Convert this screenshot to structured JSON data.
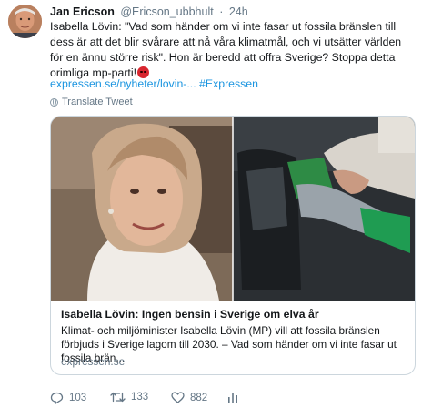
{
  "author": {
    "name": "Jan Ericson",
    "handle": "@Ericson_ubbhult",
    "separator": "·",
    "time": "24h"
  },
  "tweet": {
    "text": "Isabella Lövin: \"Vad som händer om vi inte fasar ut fossila bränslen till dess är att det blir svårare att nå våra klimatmål, och vi utsätter världen för en ännu större risk\". Hon är beredd att offra Sverige? Stoppa detta orimliga mp-parti!",
    "emoji": "angry-face-emoji",
    "link": "expressen.se/nyheter/lovin-...",
    "hashtag": "#Expressen",
    "translate_label": "Translate Tweet"
  },
  "card": {
    "title": "Isabella Lövin: Ingen bensin i Sverige om elva år",
    "description": "Klimat- och miljöminister Isabella Lövin (MP) vill att fossila bränslen förbjuds i Sverige lagom till 2030. – Vad som händer om vi inte fasar ut fossila brän...",
    "domain": "expressen.se",
    "left_image": "portrait-photo",
    "right_image": "fuel-nozzle-photo"
  },
  "actions": {
    "reply_count": "103",
    "retweet_count": "133",
    "like_count": "882",
    "icons": [
      "reply-icon",
      "retweet-icon",
      "like-icon",
      "analytics-icon"
    ]
  },
  "colors": {
    "link": "#1b95e0",
    "muted": "#657786",
    "border": "#ccd6dd",
    "emoji": "#d8262f"
  }
}
